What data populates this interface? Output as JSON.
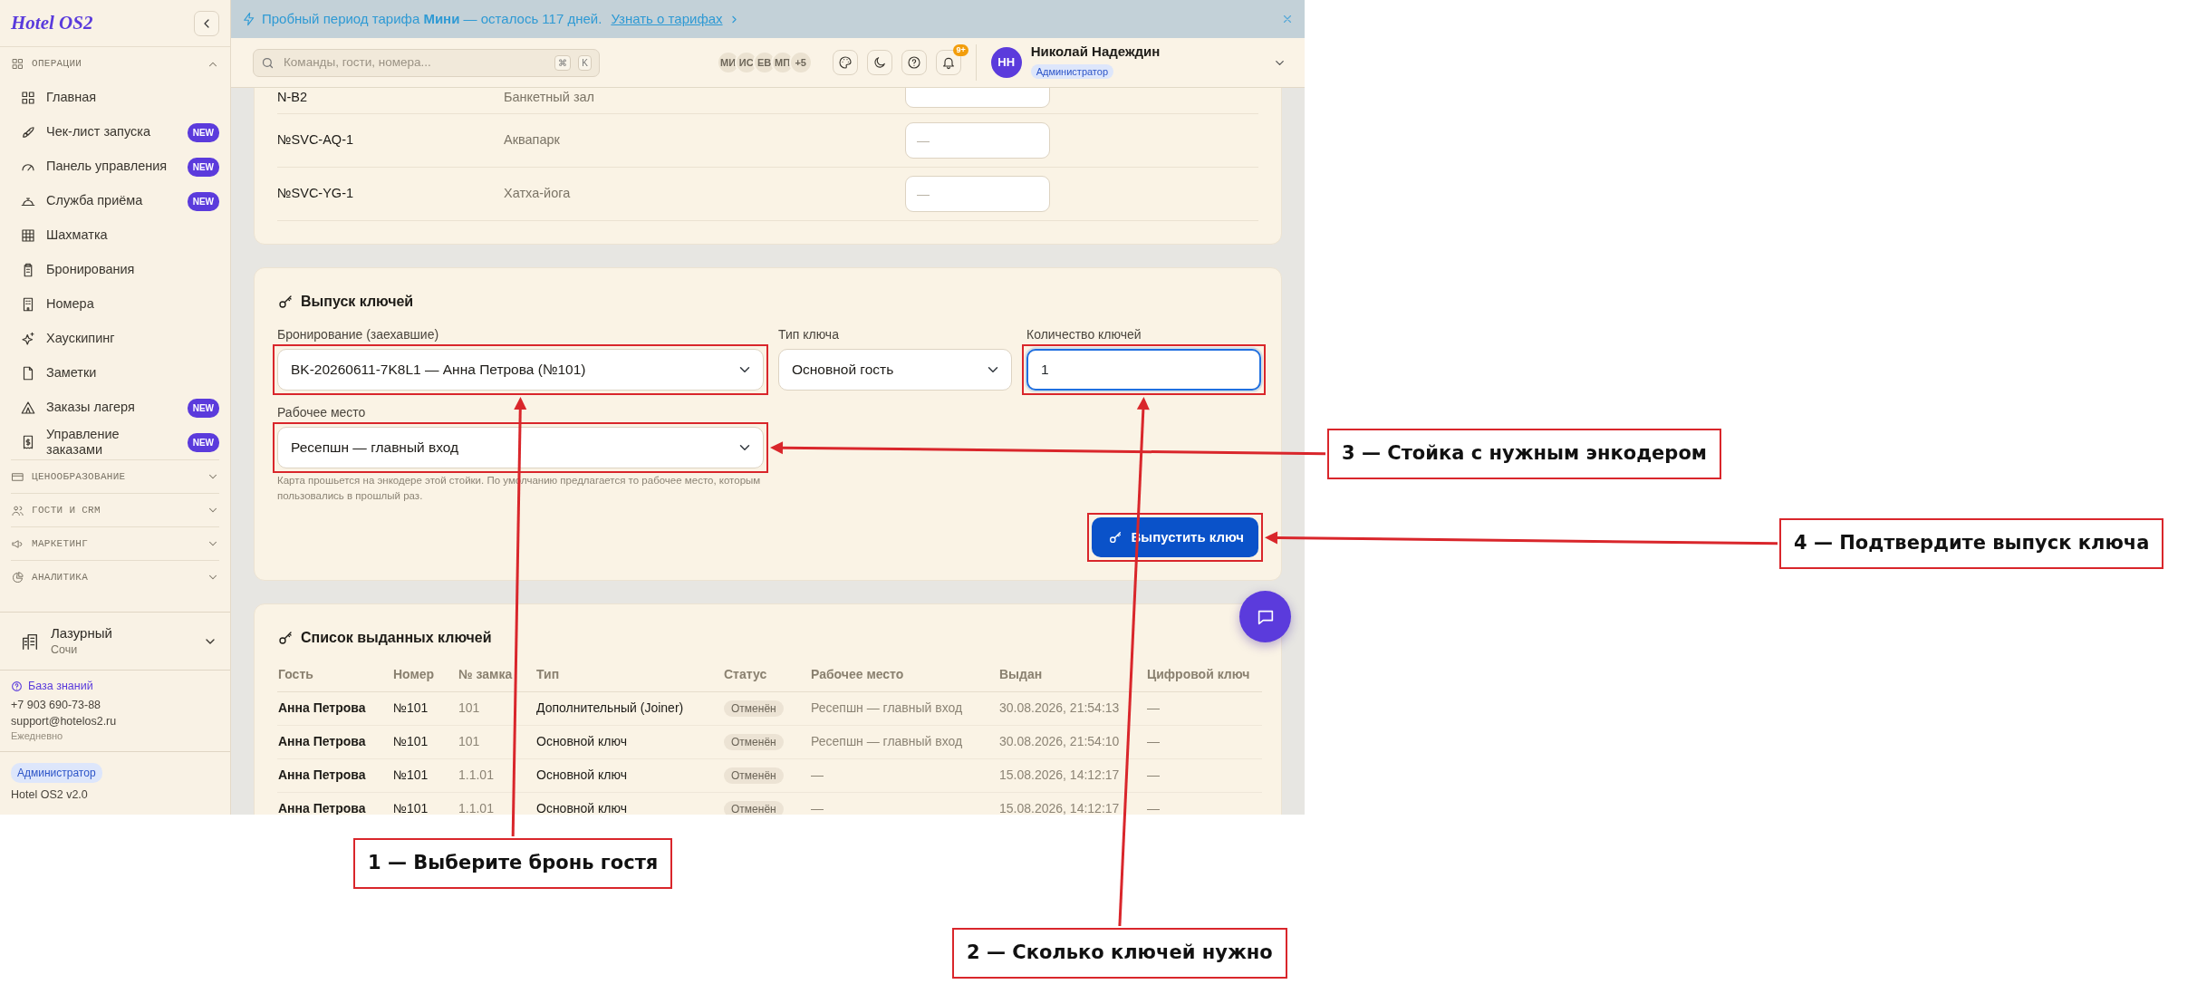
{
  "sidebar": {
    "logo": "Hotel OS2",
    "sections": [
      {
        "title": "ОПЕРАЦИИ",
        "expanded": true,
        "items": [
          {
            "label": "Главная"
          },
          {
            "label": "Чек-лист запуска",
            "badge": "NEW"
          },
          {
            "label": "Панель управления",
            "badge": "NEW"
          },
          {
            "label": "Служба приёма",
            "badge": "NEW"
          },
          {
            "label": "Шахматка"
          },
          {
            "label": "Бронирования"
          },
          {
            "label": "Номера"
          },
          {
            "label": "Хаускипинг"
          },
          {
            "label": "Заметки"
          },
          {
            "label": "Заказы лагеря",
            "badge": "NEW"
          },
          {
            "label": "Управление заказами",
            "badge": "NEW"
          }
        ]
      },
      {
        "title": "ЦЕНООБРАЗОВАНИЕ",
        "expanded": false
      },
      {
        "title": "ГОСТИ И CRM",
        "expanded": false
      },
      {
        "title": "МАРКЕТИНГ",
        "expanded": false
      },
      {
        "title": "АНАЛИТИКА",
        "expanded": false
      }
    ],
    "hotel": {
      "name": "Лазурный",
      "city": "Сочи"
    },
    "support": {
      "link": "База знаний",
      "phone": "+7 903 690-73-88",
      "email": "support@hotelos2.ru",
      "hours": "Ежедневно"
    },
    "role": "Администратор",
    "version": "Hotel OS2 v2.0"
  },
  "banner": {
    "text": "Пробный период тарифа **Мини** — осталось 117 дней.",
    "link": "Узнать о тарифах"
  },
  "header": {
    "search": {
      "placeholder": "Команды, гости, номера...",
      "keys": [
        "⌘",
        "K"
      ]
    },
    "team": [
      "МИ",
      "ИС",
      "ЕВ",
      "МП",
      "+5"
    ],
    "notifications": "9+",
    "user": {
      "initials": "НН",
      "name": "Николай Надеждин",
      "role": "Администратор"
    }
  },
  "services": {
    "rows": [
      {
        "code": "N-B2",
        "name": "Банкетный зал"
      },
      {
        "code": "№SVC-AQ-1",
        "name": "Аквапарк",
        "placeholder": "—"
      },
      {
        "code": "№SVC-YG-1",
        "name": "Хатха-йога",
        "placeholder": "—"
      }
    ]
  },
  "key_issue": {
    "title": "Выпуск ключей",
    "fields": [
      {
        "label": "Бронирование (заехавшие)",
        "kind": "select",
        "value": "BK-20260611-7K8L1 — Анна Петрова (№101)",
        "annotated": true,
        "focused": false
      },
      {
        "label": "Тип ключа",
        "kind": "select",
        "value": "Основной гость",
        "focused": false
      },
      {
        "label": "Количество ключей",
        "kind": "number",
        "value": "1",
        "annotated": true,
        "focused": true
      },
      {
        "label": "Рабочее место",
        "kind": "select",
        "value": "Ресепшн — главный вход",
        "annotated": true,
        "focused": false,
        "help": "Карта прошьется на энкодере этой стойки. По умолчанию предлагается то рабочее место, которым пользовались в прошлый раз."
      }
    ],
    "button": {
      "label": "Выпустить ключ",
      "annotated": true
    }
  },
  "issued_keys": {
    "title": "Список выданных ключей",
    "columns": [
      "Гость",
      "Номер",
      "№ замка",
      "Тип",
      "Статус",
      "Рабочее место",
      "Выдан",
      "Цифровой ключ"
    ],
    "rows": [
      {
        "guest": "Анна Петрова",
        "room": "№101",
        "lock": "101",
        "type": "Дополнительный (Joiner)",
        "status": "Отменён",
        "workplace": "Ресепшн — главный вход",
        "issued": "30.08.2026, 21:54:13",
        "digital": "—"
      },
      {
        "guest": "Анна Петрова",
        "room": "№101",
        "lock": "101",
        "type": "Основной ключ",
        "status": "Отменён",
        "workplace": "Ресепшн — главный вход",
        "issued": "30.08.2026, 21:54:10",
        "digital": "—"
      },
      {
        "guest": "Анна Петрова",
        "room": "№101",
        "lock": "1.1.01",
        "type": "Основной ключ",
        "status": "Отменён",
        "workplace": "—",
        "issued": "15.08.2026, 14:12:17",
        "digital": "—"
      },
      {
        "guest": "Анна Петрова",
        "room": "№101",
        "lock": "1.1.01",
        "type": "Основной ключ",
        "status": "Отменён",
        "workplace": "—",
        "issued": "15.08.2026, 14:12:17",
        "digital": "—"
      }
    ]
  },
  "callouts": [
    {
      "label": "1 — Выберите бронь гостя"
    },
    {
      "label": "2 — Сколько ключей нужно"
    },
    {
      "label": "3 — Стойка с нужным энкодером"
    },
    {
      "label": "4 — Подтвердите выпуск ключа"
    }
  ]
}
